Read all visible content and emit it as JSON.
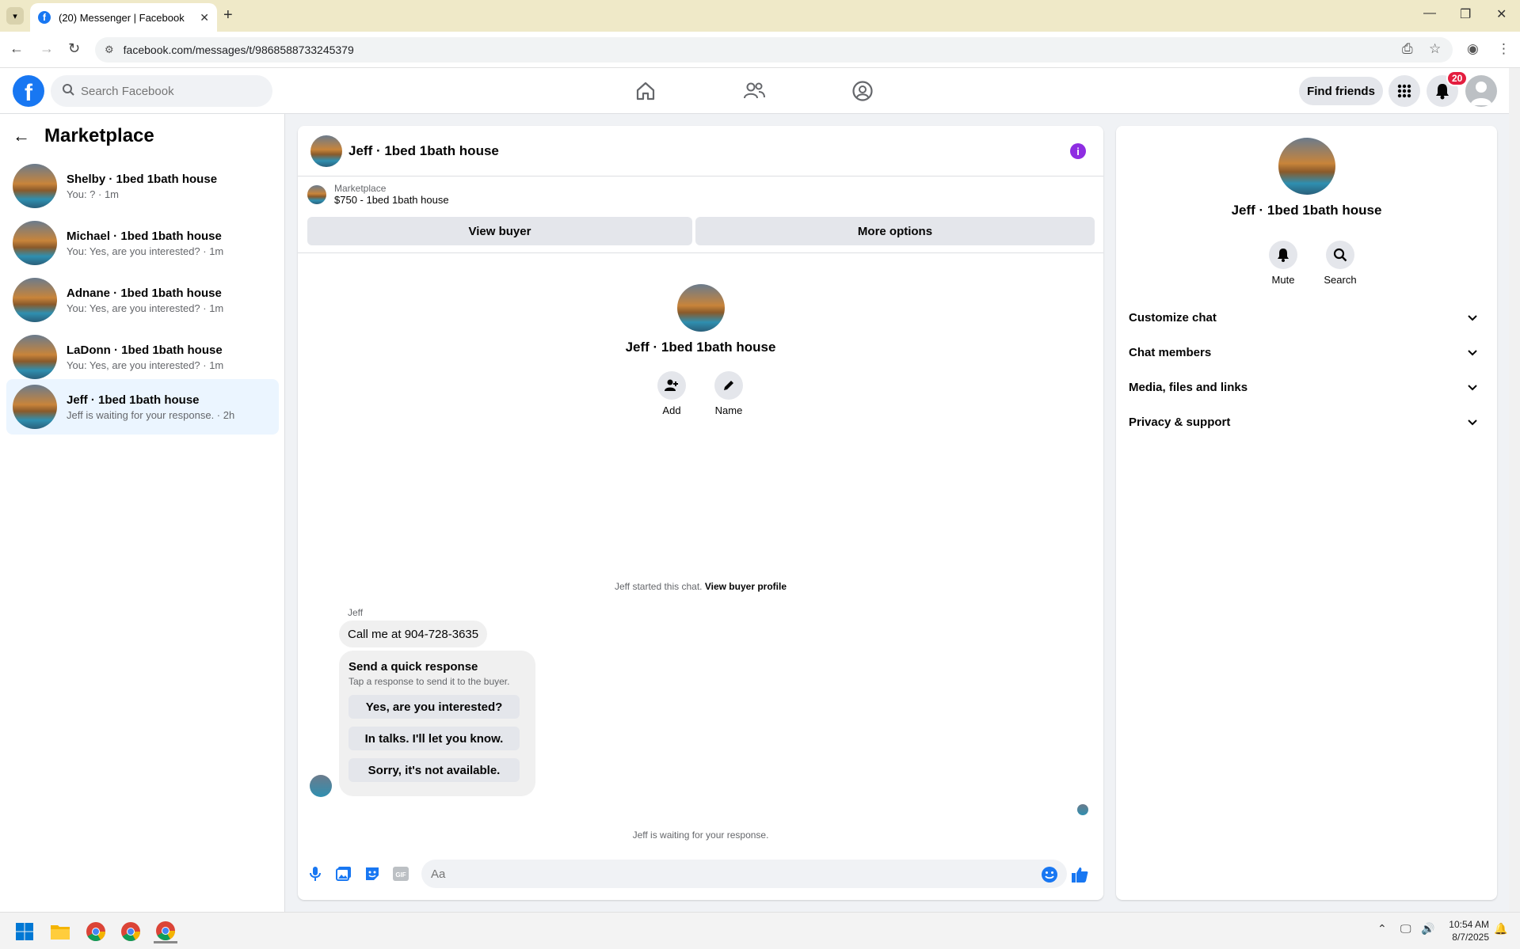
{
  "browser": {
    "tab_title": "(20) Messenger | Facebook",
    "url": "facebook.com/messages/t/9868588733245379"
  },
  "header": {
    "search_placeholder": "Search Facebook",
    "find_friends": "Find friends",
    "notification_count": "20"
  },
  "sidebar": {
    "title": "Marketplace",
    "conversations": [
      {
        "name": "Shelby · 1bed 1bath house",
        "preview": "You: ? · 1m"
      },
      {
        "name": "Michael · 1bed 1bath house",
        "preview": "You: Yes, are you interested? · 1m"
      },
      {
        "name": "Adnane · 1bed 1bath house",
        "preview": "You: Yes, are you interested? · 1m"
      },
      {
        "name": "LaDonn · 1bed 1bath house",
        "preview": "You: Yes, are you interested? · 1m"
      },
      {
        "name": "Jeff · 1bed 1bath house",
        "preview": "Jeff is waiting for your response. · 2h"
      }
    ]
  },
  "chat": {
    "title": "Jeff · 1bed 1bath house",
    "marketplace_label": "Marketplace",
    "listing": "$750 - 1bed 1bath house",
    "view_buyer": "View buyer",
    "more_options": "More options",
    "profile_name": "Jeff · 1bed 1bath house",
    "add_label": "Add",
    "name_label": "Name",
    "started_text": "Jeff started this chat.",
    "view_buyer_profile": "View buyer profile",
    "sender": "Jeff",
    "message": "Call me at 904-728-3635",
    "quick_title": "Send a quick response",
    "quick_sub": "Tap a response to send it to the buyer.",
    "quick_responses": [
      "Yes, are you interested?",
      "In talks. I'll let you know.",
      "Sorry, it's not available."
    ],
    "waiting": "Jeff is waiting for your response.",
    "input_placeholder": "Aa"
  },
  "details": {
    "name": "Jeff · 1bed 1bath house",
    "mute": "Mute",
    "search": "Search",
    "sections": [
      "Customize chat",
      "Chat members",
      "Media, files and links",
      "Privacy & support"
    ]
  },
  "taskbar": {
    "time": "10:54 AM",
    "date": "8/7/2025"
  },
  "colors": {
    "fb_blue": "#1877f2",
    "info_purple": "#8e2de2",
    "badge_red": "#e41e3f",
    "active_row": "#ebf5ff"
  }
}
